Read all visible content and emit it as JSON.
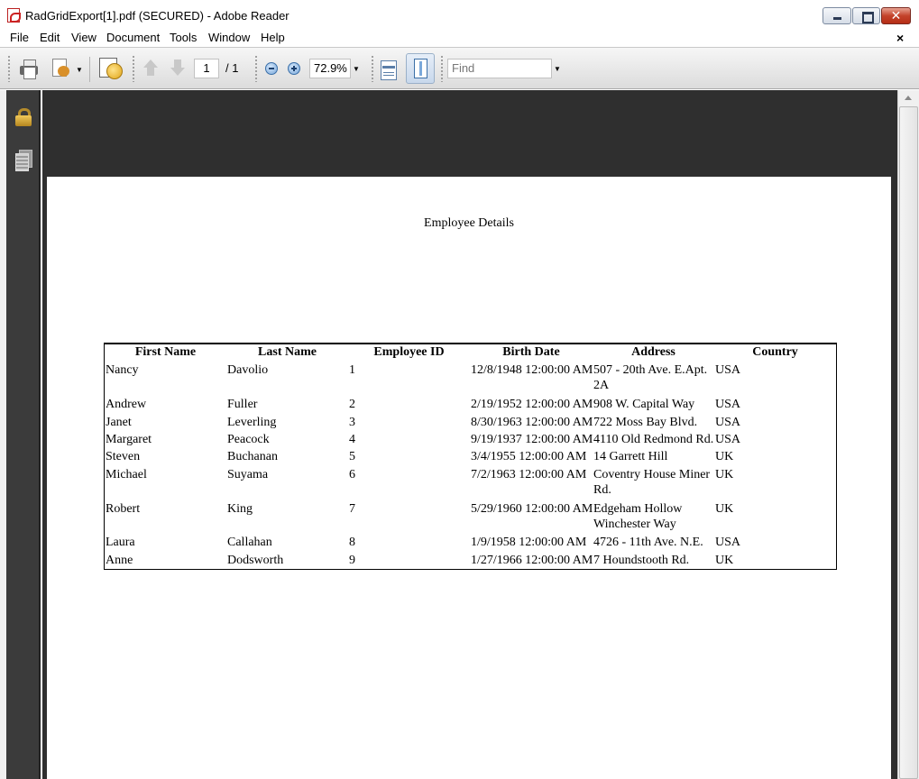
{
  "window": {
    "title": "RadGridExport[1].pdf (SECURED) - Adobe Reader",
    "close_glyph": "✕"
  },
  "menu": {
    "items": [
      "File",
      "Edit",
      "View",
      "Document",
      "Tools",
      "Window",
      "Help"
    ],
    "doc_close": "×"
  },
  "toolbar": {
    "page_current": "1",
    "page_total": "/ 1",
    "zoom": "72.9%",
    "find_placeholder": "Find",
    "dropdown_glyph": "▼"
  },
  "document": {
    "title": "Employee Details",
    "columns": [
      "First Name",
      "Last Name",
      "Employee ID",
      "Birth Date",
      "Address",
      "Country"
    ],
    "rows": [
      {
        "first": "Nancy",
        "last": "Davolio",
        "id": "1",
        "birth": "12/8/1948 12:00:00 AM",
        "address": "507 - 20th Ave. E.Apt. 2A",
        "country": "USA"
      },
      {
        "first": "Andrew",
        "last": "Fuller",
        "id": "2",
        "birth": "2/19/1952 12:00:00 AM",
        "address": "908 W. Capital Way",
        "country": "USA"
      },
      {
        "first": "Janet",
        "last": "Leverling",
        "id": "3",
        "birth": "8/30/1963 12:00:00 AM",
        "address": "722 Moss Bay Blvd.",
        "country": "USA"
      },
      {
        "first": "Margaret",
        "last": "Peacock",
        "id": "4",
        "birth": "9/19/1937 12:00:00 AM",
        "address": "4110 Old Redmond Rd.",
        "country": "USA"
      },
      {
        "first": "Steven",
        "last": "Buchanan",
        "id": "5",
        "birth": "3/4/1955 12:00:00 AM",
        "address": "14 Garrett Hill",
        "country": "UK"
      },
      {
        "first": "Michael",
        "last": "Suyama",
        "id": "6",
        "birth": "7/2/1963 12:00:00 AM",
        "address": "Coventry House Miner Rd.",
        "country": "UK"
      },
      {
        "first": "Robert",
        "last": "King",
        "id": "7",
        "birth": "5/29/1960 12:00:00 AM",
        "address": "Edgeham Hollow Winchester Way",
        "country": "UK"
      },
      {
        "first": "Laura",
        "last": "Callahan",
        "id": "8",
        "birth": "1/9/1958 12:00:00 AM",
        "address": "4726 - 11th Ave. N.E.",
        "country": "USA"
      },
      {
        "first": "Anne",
        "last": "Dodsworth",
        "id": "9",
        "birth": "1/27/1966 12:00:00 AM",
        "address": "7 Houndstooth Rd.",
        "country": "UK"
      }
    ]
  },
  "icons": {
    "app": "pdf-icon",
    "nav_security": "lock-icon",
    "nav_pages": "pages-icon"
  }
}
